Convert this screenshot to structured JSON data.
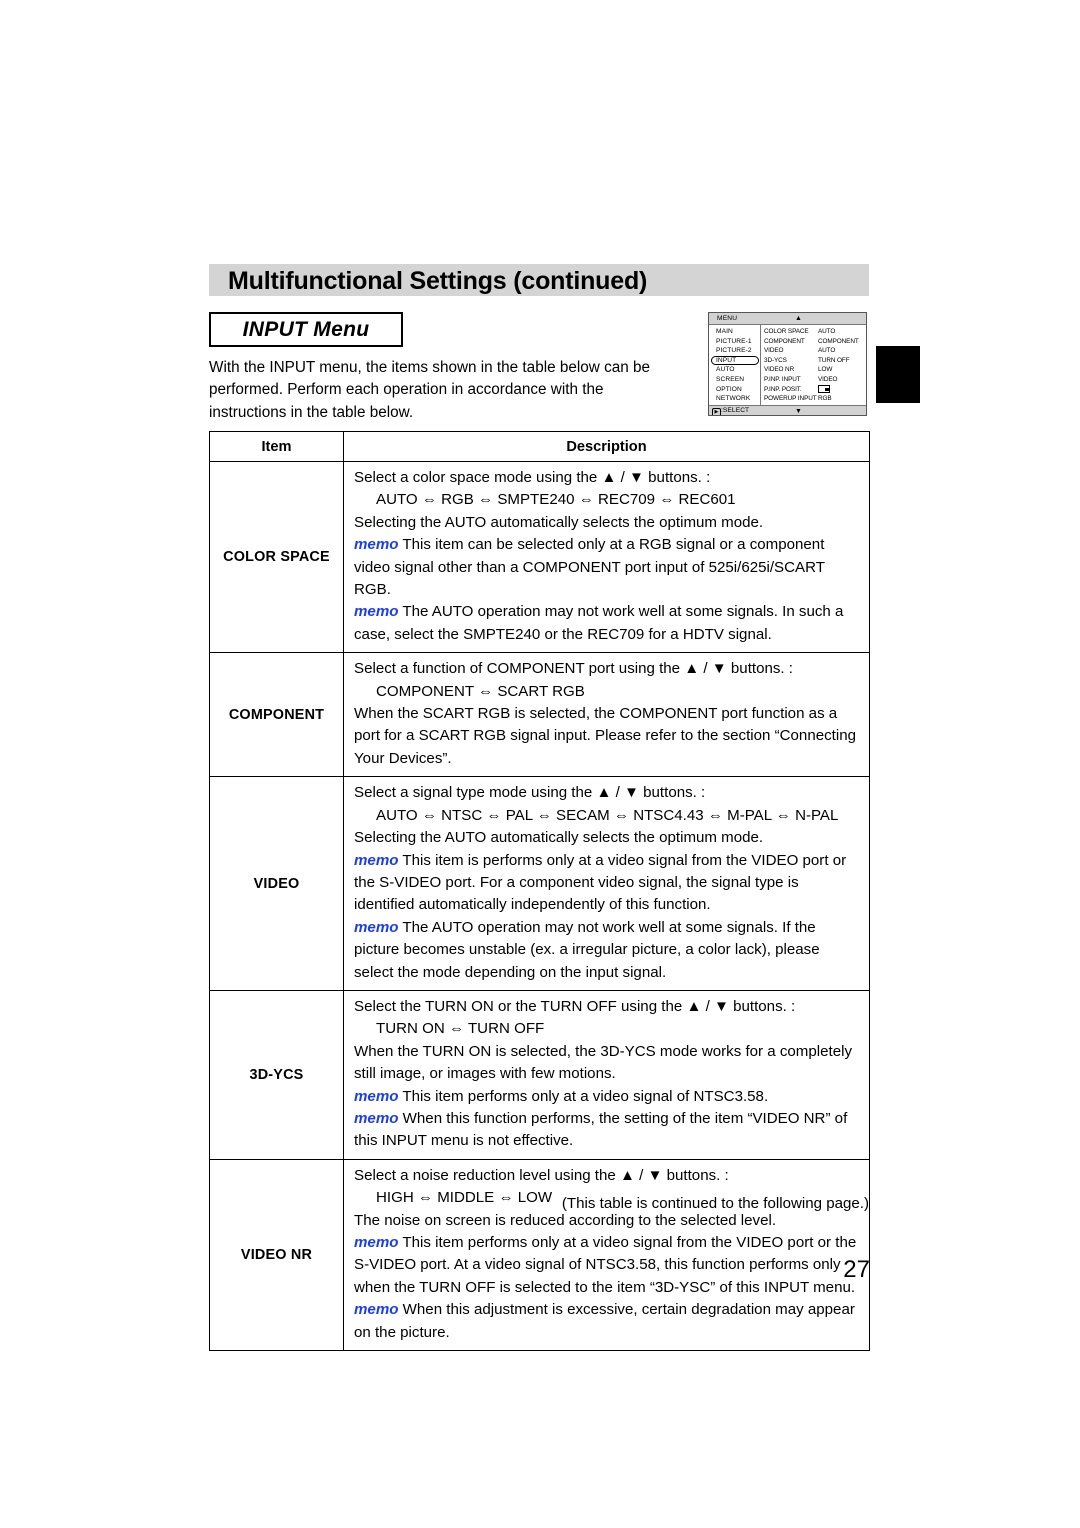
{
  "header": {
    "title": "Multifunctional Settings (continued)"
  },
  "section": {
    "title": "INPUT Menu",
    "intro": "With the INPUT menu, the items shown in the table below can be performed. Perform each operation in accordance with the instructions in the table below."
  },
  "osd_menu": {
    "title": "MENU",
    "up_arrow": "▲",
    "down_arrow": "▼",
    "select_label": ":SELECT",
    "select_glyph": "▶",
    "left_items": [
      {
        "label": "MAIN",
        "selected": false
      },
      {
        "label": "PICTURE-1",
        "selected": false
      },
      {
        "label": "PICTURE-2",
        "selected": false
      },
      {
        "label": "INPUT",
        "selected": true
      },
      {
        "label": "AUTO",
        "selected": false
      },
      {
        "label": "SCREEN",
        "selected": false
      },
      {
        "label": "OPTION",
        "selected": false
      },
      {
        "label": "NETWORK",
        "selected": false
      }
    ],
    "right_rows": [
      {
        "key": "COLOR SPACE",
        "value": "AUTO"
      },
      {
        "key": "COMPONENT",
        "value": "COMPONENT"
      },
      {
        "key": "VIDEO",
        "value": "AUTO"
      },
      {
        "key": "3D-YCS",
        "value": "TURN OFF"
      },
      {
        "key": "VIDEO NR",
        "value": "LOW"
      },
      {
        "key": "P.INP. INPUT",
        "value": "VIDEO"
      },
      {
        "key": "P.INP. POSIT.",
        "value": "",
        "value_icon": "position-icon"
      },
      {
        "key": "POWERUP INPUT",
        "value": "RGB"
      }
    ]
  },
  "table": {
    "headers": {
      "item": "Item",
      "description": "Description"
    },
    "rows": [
      {
        "item": "COLOR SPACE",
        "lines": [
          {
            "text": "Select a color space mode using the ▲ / ▼ buttons. :"
          },
          {
            "text": "AUTO ⇔ RGB ⇔ SMPTE240 ⇔ REC709 ⇔ REC601",
            "indent": true
          },
          {
            "text": "Selecting the AUTO automatically selects the optimum mode."
          },
          {
            "memo": "memo",
            "text": " This item can be selected only at a RGB signal or a component video signal other than a COMPONENT port input of 525i/625i/SCART RGB."
          },
          {
            "memo": "memo",
            "text": " The AUTO operation may not work well at some signals. In such a case, select the SMPTE240 or the REC709 for a HDTV signal."
          }
        ]
      },
      {
        "item": "COMPONENT",
        "lines": [
          {
            "text": "Select a function of COMPONENT port using the ▲ / ▼ buttons. :"
          },
          {
            "text": "COMPONENT ⇔ SCART RGB",
            "indent": true
          },
          {
            "text": "When the SCART RGB is selected, the COMPONENT port function as a port for a SCART RGB signal input. Please refer to the section “Connecting Your Devices”."
          }
        ]
      },
      {
        "item": "VIDEO",
        "lines": [
          {
            "text": "Select a signal type mode using the ▲ / ▼ buttons. :"
          },
          {
            "text": "AUTO ⇔ NTSC ⇔ PAL ⇔ SECAM ⇔ NTSC4.43 ⇔ M-PAL ⇔ N-PAL",
            "indent": true
          },
          {
            "text": "Selecting the AUTO automatically selects the optimum mode."
          },
          {
            "memo": "memo",
            "text": " This item is performs only at a video signal from the VIDEO port or the S-VIDEO port. For a component video signal, the signal type is identified automatically independently of this function."
          },
          {
            "memo": "memo",
            "text": " The AUTO operation may not work well at some signals. If the picture becomes unstable (ex. a irregular picture, a color lack), please select the mode depending on the input signal."
          }
        ]
      },
      {
        "item": "3D-YCS",
        "lines": [
          {
            "text": "Select the TURN ON or the TURN OFF using the ▲ / ▼ buttons. :"
          },
          {
            "text": "TURN ON ⇔ TURN OFF",
            "indent": true
          },
          {
            "text": "When the TURN ON is selected, the 3D-YCS mode works for a completely still image, or images with few motions."
          },
          {
            "memo": "memo",
            "text": " This item performs only at a video signal of NTSC3.58."
          },
          {
            "memo": "memo",
            "text": " When this function performs, the setting of the item “VIDEO NR” of this INPUT menu is not effective."
          }
        ]
      },
      {
        "item": "VIDEO NR",
        "lines": [
          {
            "text": "Select a noise reduction level using the ▲ / ▼ buttons. :"
          },
          {
            "text": "HIGH ⇔ MIDDLE ⇔ LOW",
            "indent": true
          },
          {
            "text": "The noise on screen is reduced according to the selected level."
          },
          {
            "memo": "memo",
            "text": " This item performs only at a video signal from the VIDEO port or the S-VIDEO port. At a video signal of NTSC3.58, this function performs only when the TURN OFF is selected to the item “3D-YSC” of this INPUT menu."
          },
          {
            "memo": "memo",
            "text": " When this adjustment is excessive, certain degradation may appear on the picture."
          }
        ]
      }
    ]
  },
  "footnote": "(This table is continued to the following page.)",
  "page_number": "27"
}
